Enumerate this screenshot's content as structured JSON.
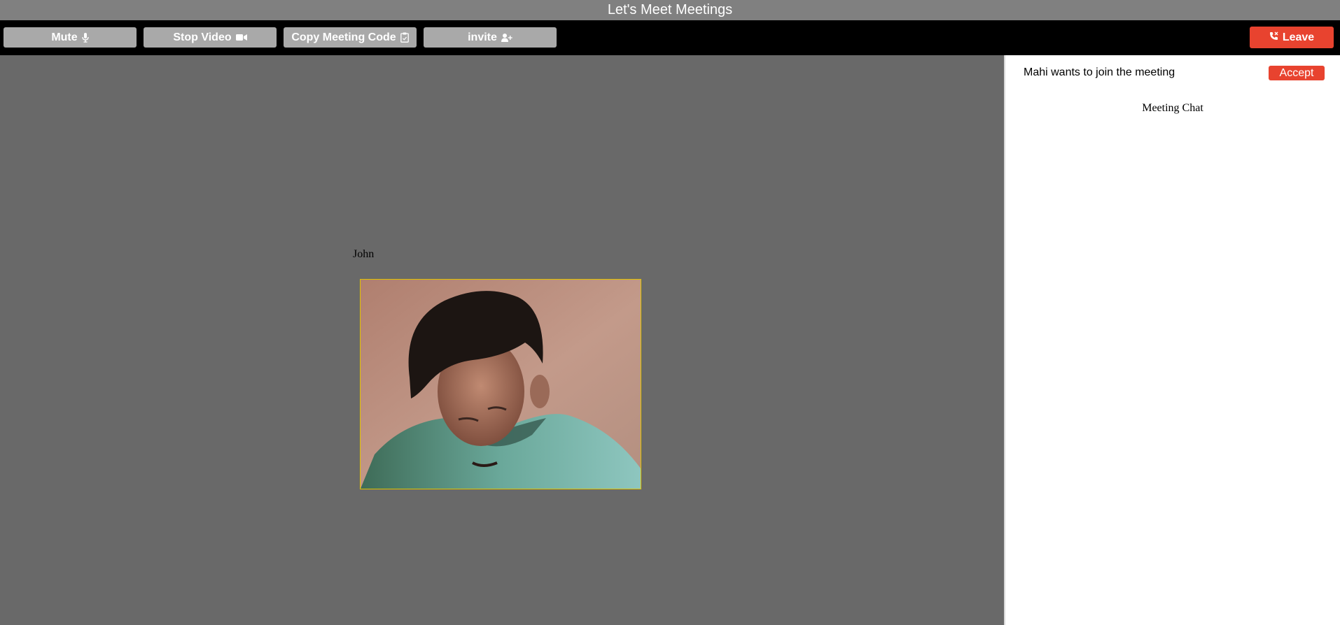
{
  "window": {
    "title": "Let's Meet Meetings"
  },
  "toolbar": {
    "mute_label": "Mute",
    "stop_video_label": "Stop Video",
    "copy_code_label": "Copy Meeting Code",
    "invite_label": "invite",
    "leave_label": "Leave"
  },
  "main": {
    "participant_name": "John"
  },
  "sidebar": {
    "join_request_text": "Mahi wants to join the meeting",
    "accept_label": "Accept",
    "chat_title": "Meeting Chat"
  },
  "icons": {
    "mute": "microphone-icon",
    "stop_video": "video-camera-icon",
    "copy_code": "clipboard-icon",
    "invite": "user-plus-icon",
    "leave": "phone-hangup-icon"
  },
  "colors": {
    "leave": "#e8432f",
    "accept": "#e8432f",
    "toolbar_button": "#a9a9a9",
    "video_border": "#e0c200"
  }
}
